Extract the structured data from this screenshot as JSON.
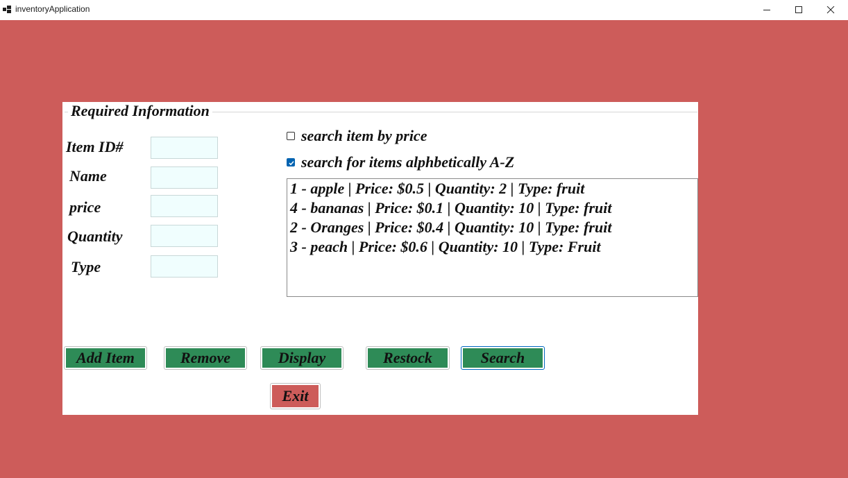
{
  "window": {
    "title": "inventoryApplication"
  },
  "group": {
    "title": "Required Information",
    "fields": [
      {
        "label": "Item ID#",
        "value": ""
      },
      {
        "label": "Name",
        "value": ""
      },
      {
        "label": "price",
        "value": ""
      },
      {
        "label": "Quantity",
        "value": ""
      },
      {
        "label": "Type",
        "value": ""
      }
    ]
  },
  "search_options": [
    {
      "label": "search item by price",
      "checked": false
    },
    {
      "label": "search for items alphbetically A-Z",
      "checked": true
    }
  ],
  "items": [
    "1 - apple | Price: $0.5 | Quantity: 2 | Type: fruit",
    "4 - bananas | Price: $0.1 | Quantity: 10 | Type: fruit",
    "2 - Oranges | Price: $0.4 | Quantity: 10 | Type: fruit",
    "3 - peach | Price: $0.6 | Quantity: 10 | Type: Fruit"
  ],
  "buttons": {
    "add": "Add Item",
    "remove": "Remove",
    "display": "Display",
    "restock": "Restock",
    "search": "Search",
    "exit": "Exit"
  },
  "colors": {
    "background": "#cd5c5a",
    "button_green": "#2e8b57",
    "exit_button": "#cd5c5a",
    "textbox": "#f0fefe",
    "checkbox_checked": "#0063b1"
  }
}
